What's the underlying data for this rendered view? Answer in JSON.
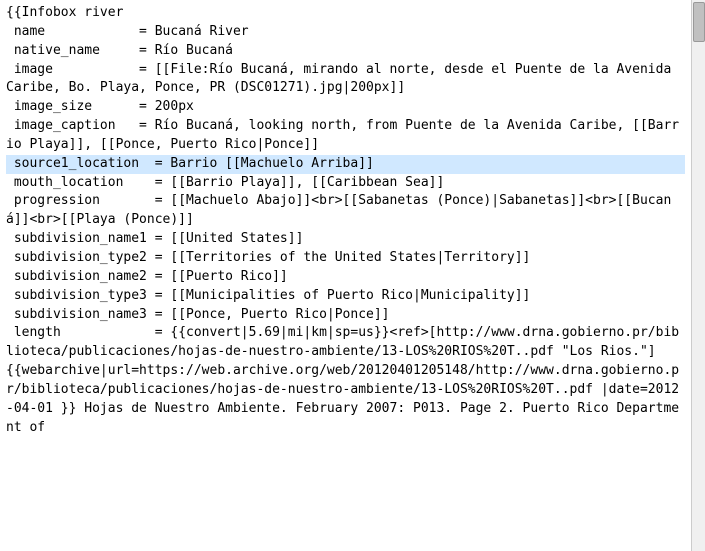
{
  "lines": [
    {
      "text": "{{Infobox river",
      "highlight": false
    },
    {
      "text": " name            = Bucaná River",
      "highlight": false
    },
    {
      "text": " native_name     = Río Bucaná",
      "highlight": false
    },
    {
      "text": " image           = [[File:Río Bucaná, mirando al norte, desde el Puente de la Avenida Caribe, Bo. Playa, Ponce, PR (DSC01271).jpg|200px]]",
      "highlight": false
    },
    {
      "text": " image_size      = 200px",
      "highlight": false
    },
    {
      "text": " image_caption   = Río Bucaná, looking north, from Puente de la Avenida Caribe, [[Barrio Playa]], [[Ponce, Puerto Rico|Ponce]]",
      "highlight": false
    },
    {
      "text": " source1_location  = Barrio [[Machuelo Arriba]]",
      "highlight": true
    },
    {
      "text": " mouth_location    = [[Barrio Playa]], [[Caribbean Sea]]",
      "highlight": false
    },
    {
      "text": " progression       = [[Machuelo Abajo]]<br>[[Sabanetas (Ponce)|Sabanetas]]<br>[[Bucaná]]<br>[[Playa (Ponce)]]",
      "highlight": false
    },
    {
      "text": " subdivision_name1 = [[United States]]",
      "highlight": false
    },
    {
      "text": " subdivision_type2 = [[Territories of the United States|Territory]]",
      "highlight": false
    },
    {
      "text": " subdivision_name2 = [[Puerto Rico]]",
      "highlight": false
    },
    {
      "text": " subdivision_type3 = [[Municipalities of Puerto Rico|Municipality]]",
      "highlight": false
    },
    {
      "text": " subdivision_name3 = [[Ponce, Puerto Rico|Ponce]]",
      "highlight": false
    },
    {
      "text": " length            = {{convert|5.69|mi|km|sp=us}}<ref>[http://www.drna.gobierno.pr/biblioteca/publicaciones/hojas-de-nuestro-ambiente/13-LOS%20RIOS%20T..pdf \"Los Rios.\"]",
      "highlight": false
    },
    {
      "text": "{{webarchive|url=https://web.archive.org/web/20120401205148/http://www.drna.gobierno.pr/biblioteca/publicaciones/hojas-de-nuestro-ambiente/13-LOS%20RIOS%20T..pdf |date=2012-04-01 }} Hojas de Nuestro Ambiente. February 2007: P013. Page 2. Puerto Rico Department of",
      "highlight": false
    }
  ]
}
